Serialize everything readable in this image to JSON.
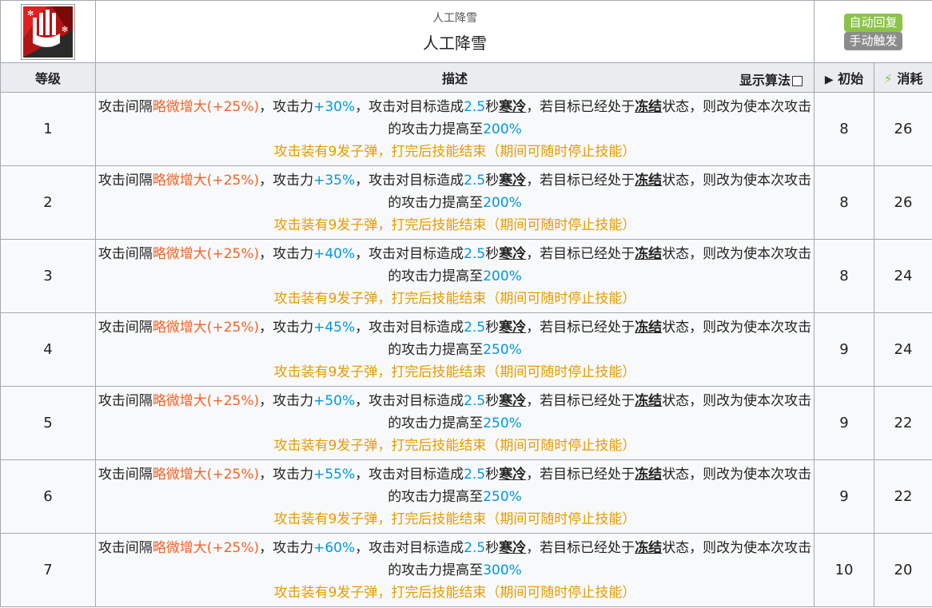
{
  "skill": {
    "name_small": "人工降雪",
    "name": "人工降雪",
    "icon_name": "snow-fist-icon",
    "tags": [
      "自动回复",
      "手动触发"
    ]
  },
  "headers": {
    "level": "等级",
    "description": "描述",
    "show_algorithm": "显示算法",
    "initial_icon": "▶",
    "initial": "初始",
    "cost_icon": "⚡",
    "cost": "消耗"
  },
  "text": {
    "p1": "攻击间隔",
    "p2": "略微增大(+25%)",
    "p3": "，攻击力",
    "p5": "，攻击对目标造成",
    "p6": "2.5",
    "p7": "秒",
    "p8": "寒冷",
    "p9": "，若目标已经处于",
    "p10": "冻结",
    "p11": "状态，则改为使本次攻击的攻击力提高至",
    "p13": "攻击装有9发子弹，打完后技能结束（期间可随时停止技能）"
  },
  "rows": [
    {
      "level": "1",
      "atk": "+30%",
      "boost": "200%",
      "init": "8",
      "cost": "26"
    },
    {
      "level": "2",
      "atk": "+35%",
      "boost": "200%",
      "init": "8",
      "cost": "26"
    },
    {
      "level": "3",
      "atk": "+40%",
      "boost": "200%",
      "init": "8",
      "cost": "24"
    },
    {
      "level": "4",
      "atk": "+45%",
      "boost": "250%",
      "init": "9",
      "cost": "24"
    },
    {
      "level": "5",
      "atk": "+50%",
      "boost": "250%",
      "init": "9",
      "cost": "22"
    },
    {
      "level": "6",
      "atk": "+55%",
      "boost": "250%",
      "init": "9",
      "cost": "22"
    },
    {
      "level": "7",
      "atk": "+60%",
      "boost": "300%",
      "init": "10",
      "cost": "20"
    }
  ],
  "colors": {
    "orange": "#f0642a",
    "blue": "#0098dc",
    "gold": "#e49c00",
    "green_tag": "#8bc34a",
    "gray_tag": "#8c8c8c",
    "header_bg": "#eaecf0"
  }
}
